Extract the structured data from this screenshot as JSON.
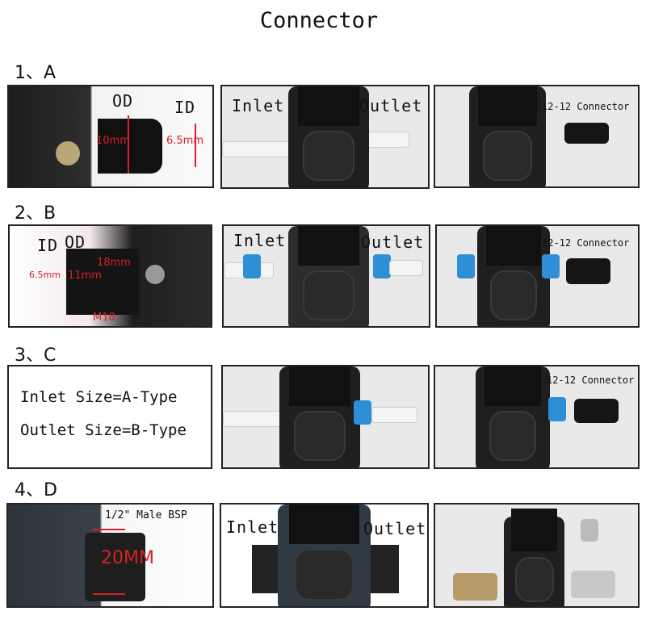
{
  "title": "Connector",
  "sections": [
    {
      "label": "1、A",
      "panel1": {
        "od": "OD",
        "id": "ID",
        "od_size": "10mm",
        "id_size": "6.5mm"
      },
      "panel2": {
        "inlet": "Inlet",
        "outlet": "Outlet"
      },
      "panel3": {
        "connector": "12-12 Connector"
      }
    },
    {
      "label": "2、B",
      "panel1": {
        "id": "ID",
        "od": "OD",
        "id_size": "6.5mm",
        "od_size": "11mm",
        "thread_size": "18mm",
        "thread": "M18"
      },
      "panel2": {
        "inlet": "Inlet",
        "outlet": "Outlet"
      },
      "panel3": {
        "connector": "12-12 Connector"
      }
    },
    {
      "label": "3、C",
      "panel1": {
        "line1": "Inlet Size=A-Type",
        "line2": "Outlet Size=B-Type"
      },
      "panel3": {
        "connector": "12-12 Connector"
      }
    },
    {
      "label": "4、D",
      "panel1": {
        "thread": "1/2\" Male BSP",
        "size": "20MM"
      },
      "panel2": {
        "inlet": "Inlet",
        "outlet": "Outlet"
      }
    }
  ],
  "colors": {
    "annotation": "#d8202a",
    "connector_blue": "#2e8fd6"
  }
}
